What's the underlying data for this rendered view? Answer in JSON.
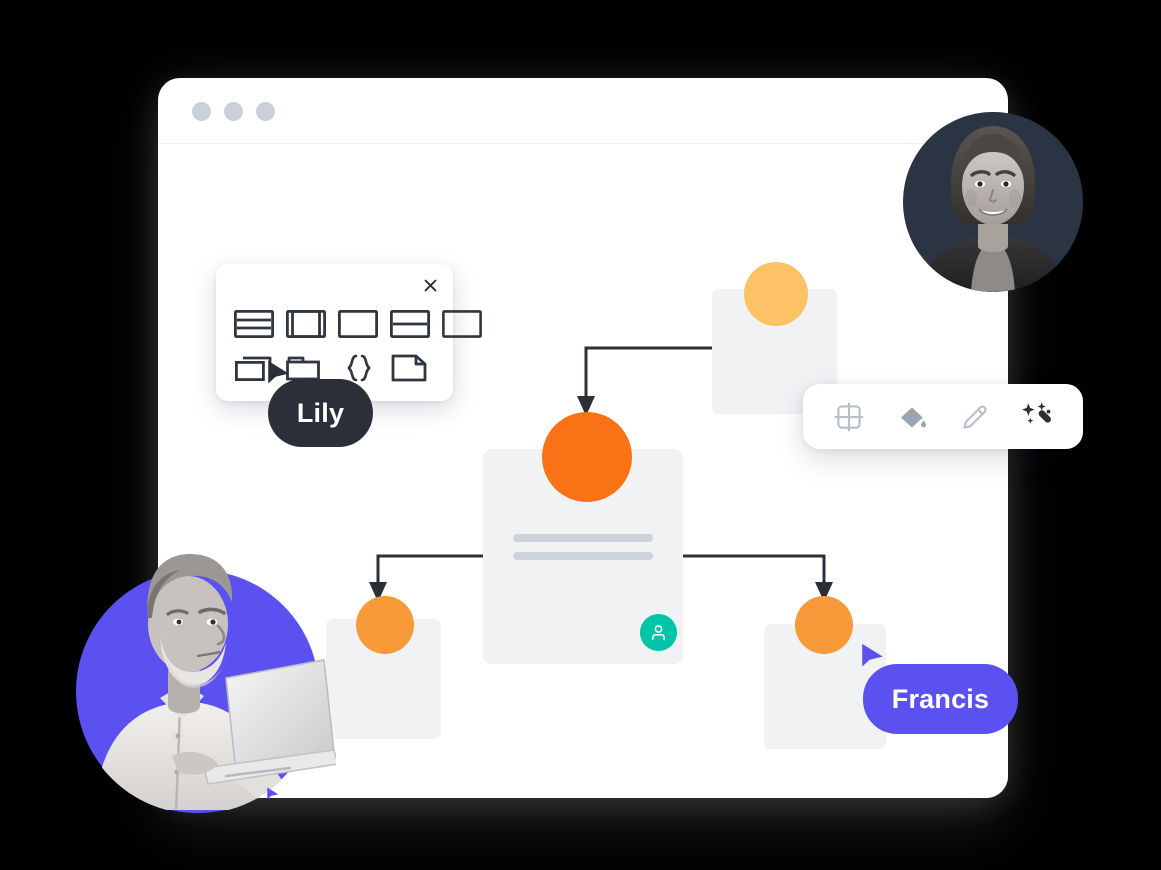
{
  "window": {
    "traffic_lights": [
      "dot-1",
      "dot-2",
      "dot-3"
    ],
    "dot_color": "#c9d0da",
    "background": "#ffffff"
  },
  "layout_panel": {
    "close_icon": "close-icon",
    "row_1": [
      {
        "name": "layout-rows-icon",
        "label": "Rows layout"
      },
      {
        "name": "layout-inset-icon",
        "label": "Inset layout"
      },
      {
        "name": "layout-blank-icon",
        "label": "Blank layout"
      },
      {
        "name": "layout-split-icon",
        "label": "Split layout"
      },
      {
        "name": "layout-empty-icon",
        "label": "Empty layout"
      }
    ],
    "row_2": [
      {
        "name": "layout-stack-icon",
        "label": "Stacked cards"
      },
      {
        "name": "layout-folder-icon",
        "label": "Folder"
      },
      {
        "name": "layout-code-icon",
        "label": "Code block"
      },
      {
        "name": "layout-file-icon",
        "label": "File"
      }
    ]
  },
  "toolbar": {
    "tools": [
      {
        "name": "crop-frame-icon",
        "label": "Frame",
        "active": false
      },
      {
        "name": "paint-bucket-icon",
        "label": "Fill",
        "active": false
      },
      {
        "name": "pencil-icon",
        "label": "Draw",
        "active": false
      },
      {
        "name": "magic-wand-icon",
        "label": "Magic",
        "active": true
      }
    ],
    "active_color": "#2b3038",
    "inactive_color": "#9aa4b2"
  },
  "diagram": {
    "nodes": [
      {
        "id": "node-top",
        "circle_color": "#fcc265",
        "card_color": "#f0f2f4"
      },
      {
        "id": "node-center",
        "circle_color": "#f97316",
        "card_color": "#f0f2f4",
        "badge": "user-icon",
        "badge_color": "#00c4a7",
        "lines": 2
      },
      {
        "id": "node-left",
        "circle_color": "#f99a3a",
        "card_color": "#f0f2f4"
      },
      {
        "id": "node-right",
        "circle_color": "#f99a3a",
        "card_color": "#f0f2f4"
      }
    ],
    "connector_color": "#2b3038",
    "placeholder_bar_color": "#ccd3db"
  },
  "collaborators": [
    {
      "name": "Lily",
      "color": "#2b3038",
      "cursor": "cursor-arrow-dark"
    },
    {
      "name": "Francis",
      "color": "#5b50f0",
      "cursor": "cursor-arrow-purple"
    }
  ],
  "avatars": [
    {
      "name": "avatar-woman",
      "alt": "Smiling woman portrait",
      "backdrop": "#2b3443"
    },
    {
      "name": "avatar-man",
      "alt": "Man working on laptop",
      "backdrop": "#5b50f0"
    }
  ]
}
